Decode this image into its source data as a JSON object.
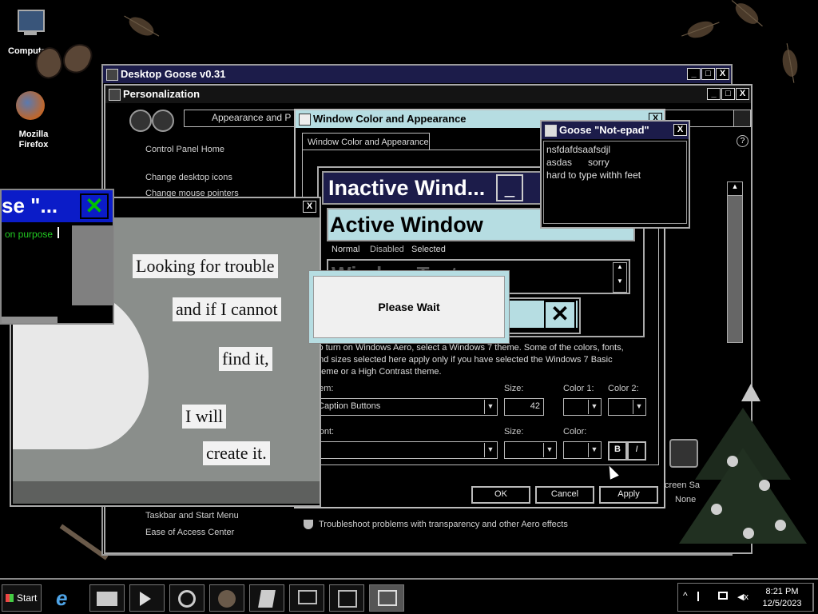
{
  "desktop": {
    "icons": [
      {
        "label": "Computer"
      },
      {
        "label": "Mozilla Firefox"
      }
    ]
  },
  "goose_main": {
    "title": "Desktop Goose v0.31",
    "controls": [
      "_",
      "□",
      "X"
    ]
  },
  "personalization": {
    "title": "Personalization",
    "address": "Appearance and P",
    "sidebar": [
      "Control Panel Home",
      "Change desktop icons",
      "Change mouse pointers"
    ],
    "see_also": [
      "Taskbar and Start Menu",
      "Ease of Access Center"
    ]
  },
  "appearance": {
    "title": "Window Color and Appearance",
    "tab": "Window Color and Appearance",
    "preview": {
      "inactive": "Inactive Wind...",
      "active": "Active Window",
      "menu": [
        "Normal",
        "Disabled",
        "Selected"
      ],
      "window_text": "Window Text"
    },
    "info": "To turn on Windows Aero, select a Windows 7 theme.  Some of the colors, fonts, and sizes selected here apply only if you have selected the Windows 7 Basic theme or a High Contrast theme.",
    "item_label": "Item:",
    "item_value": "Caption Buttons",
    "size_label": "Size:",
    "size_value": "42",
    "color1_label": "Color 1:",
    "color2_label": "Color 2:",
    "font_label": "Font:",
    "font_size_label": "Size:",
    "font_color_label": "Color:",
    "bold_label": "B",
    "italic_label": "I",
    "buttons": {
      "ok": "OK",
      "cancel": "Cancel",
      "apply": "Apply"
    },
    "troubleshoot": "Troubleshoot problems with transparency and other Aero effects"
  },
  "notepad": {
    "title": "Goose \"Not-epad\"",
    "lines": [
      "nsfdafdsaafsdjl",
      "asdas      sorry",
      "hard to type withh feet"
    ]
  },
  "goose_msg": {
    "title_fragment": "se \"...",
    "text": "on purpose"
  },
  "meme": {
    "lines": [
      "Looking for trouble",
      "and if I cannot",
      "find it,",
      "I will",
      "create it."
    ]
  },
  "please_wait": {
    "text": "Please Wait"
  },
  "partial_labels": {
    "screen_saver": "creen Sa",
    "none": "None"
  },
  "taskbar": {
    "start": "Start",
    "time": "8:21 PM",
    "date": "12/5/2023"
  },
  "colors": {
    "title_bar": "#1c1c4a",
    "goose_title": "#0b1cc8",
    "active_preview": "#b6dde2",
    "close_green": "#00c000"
  }
}
